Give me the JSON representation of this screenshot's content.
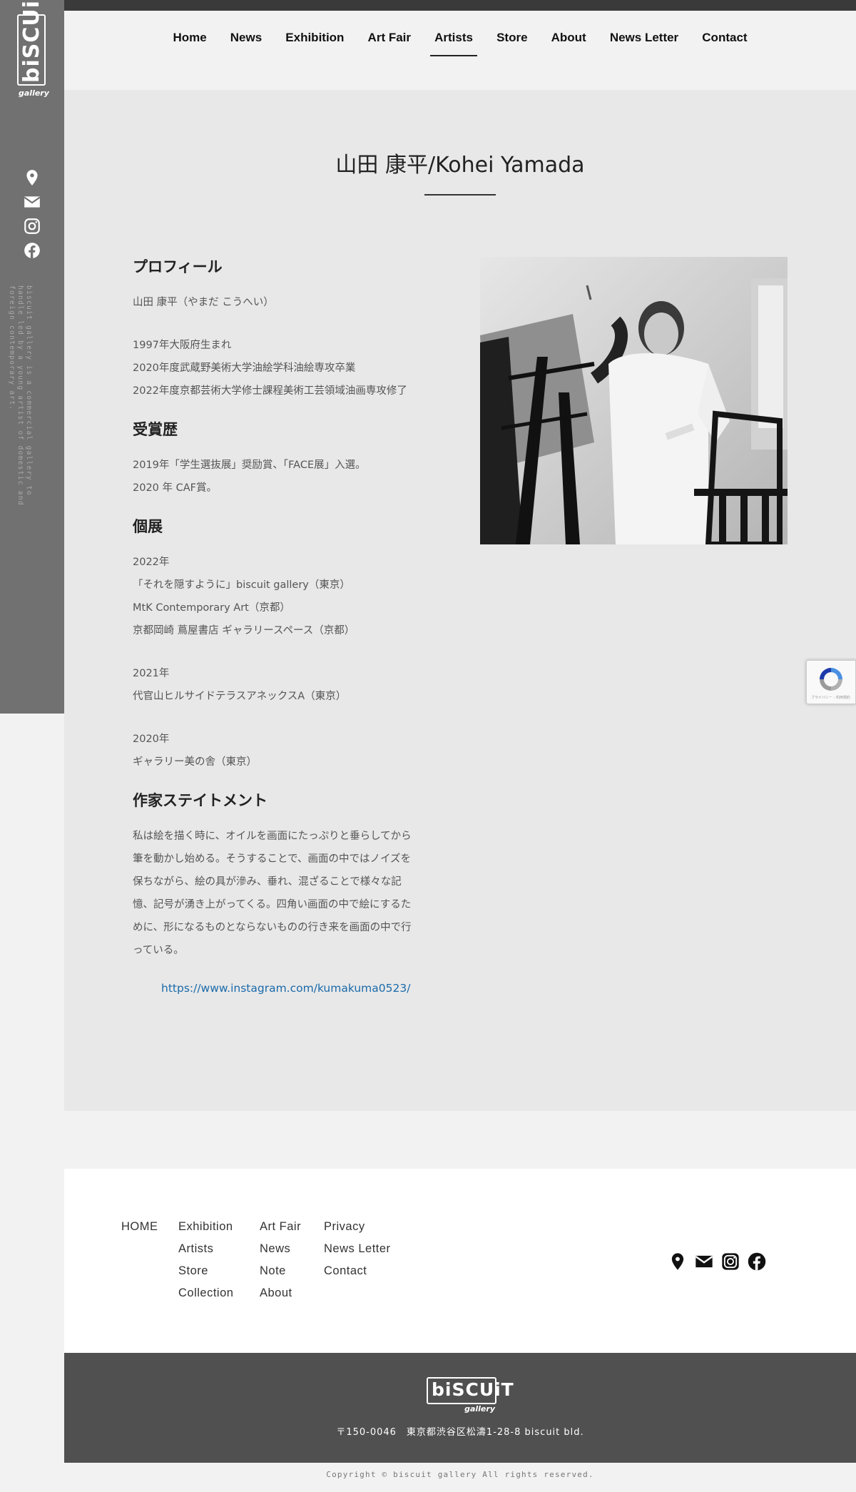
{
  "brand": {
    "logo_text": "biSCUiT",
    "logo_sub": "gallery",
    "tagline": "biscuit gallery is a commercial gallery to handle led by a young artist of domestic and foreign contemporary art."
  },
  "nav": {
    "items": [
      {
        "label": "Home"
      },
      {
        "label": "News"
      },
      {
        "label": "Exhibition"
      },
      {
        "label": "Art Fair"
      },
      {
        "label": "Artists"
      },
      {
        "label": "Store"
      },
      {
        "label": "About"
      },
      {
        "label": "News Letter"
      },
      {
        "label": "Contact"
      }
    ],
    "active": "Artists"
  },
  "artist": {
    "title": "山田 康平/Kohei Yamada",
    "profile_heading": "プロフィール",
    "profile_name": "山田 康平（やまだ こうへい）",
    "profile_lines": [
      "1997年大阪府生まれ",
      "2020年度武蔵野美術大学油絵学科油絵専攻卒業",
      "2022年度京都芸術大学修士課程美術工芸領域油画専攻修了"
    ],
    "awards_heading": "受賞歴",
    "awards_lines": [
      "2019年「学生選抜展」奨励賞、「FACE展」入選。",
      "2020 年 CAF賞。"
    ],
    "solo_heading": "個展",
    "solo_2022": [
      "2022年",
      "「それを隠すように」biscuit gallery（東京）",
      "MtK Contemporary Art（京都）",
      "京都岡崎 蔦屋書店 ギャラリースペース（京都）"
    ],
    "solo_2021": [
      "2021年",
      "代官山ヒルサイドテラスアネックスA（東京）"
    ],
    "solo_2020": [
      "2020年",
      "ギャラリー美の舎（東京）"
    ],
    "statement_heading": "作家ステイトメント",
    "statement_lines": [
      "私は絵を描く時に、オイルを画面にたっぷりと垂らしてから",
      "筆を動かし始める。そうすることで、画面の中ではノイズを",
      "保ちながら、絵の具が滲み、垂れ、混ざることで様々な記",
      "憶、記号が湧き上がってくる。四角い画面の中で絵にするた",
      "めに、形になるものとならないものの行き来を画面の中で行",
      "っている。"
    ],
    "instagram_url": "https://www.instagram.com/kumakuma0523/"
  },
  "recaptcha": {
    "text": "プライバシー - 利用規約"
  },
  "footer": {
    "col1": [
      "HOME"
    ],
    "col2": [
      "Exhibition",
      "Artists",
      "Store",
      "Collection"
    ],
    "col3": [
      "Art Fair",
      "News",
      "Note",
      "About"
    ],
    "col4": [
      "Privacy",
      "News Letter",
      "Contact"
    ],
    "address": "〒150-0046　東京都渋谷区松濤1-28-8 biscuit bld.",
    "copyright": "Copyright © biscuit gallery All rights reserved."
  },
  "icons": [
    "location-pin-icon",
    "mail-icon",
    "instagram-icon",
    "facebook-icon"
  ],
  "colors": {
    "sidebar": "#717171",
    "main_bg": "#e8e8e8",
    "footer_dark": "#505050",
    "link": "#1a6aaa"
  }
}
